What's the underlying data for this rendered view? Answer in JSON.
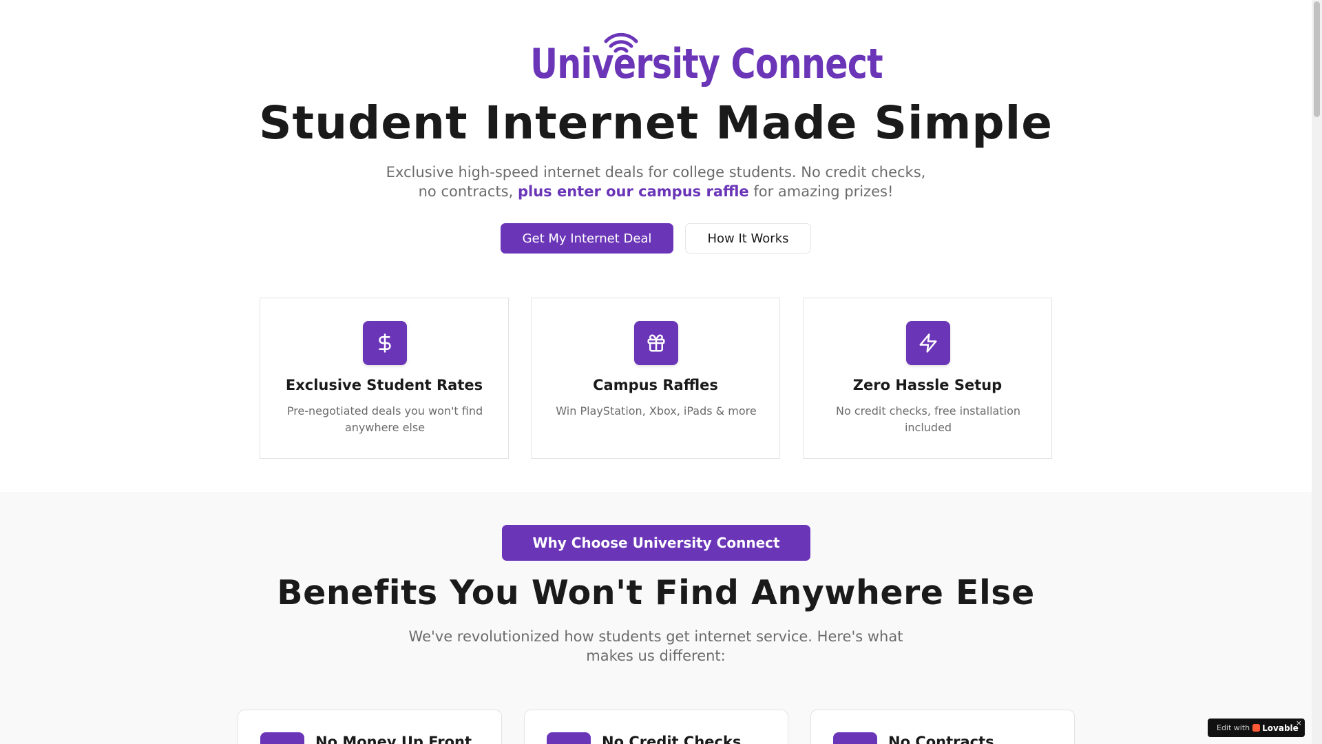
{
  "brand": {
    "logo_text": "University Connect",
    "accent_color": "#6b35b8"
  },
  "hero": {
    "title": "Student Internet Made Simple",
    "subtitle_part1": "Exclusive high-speed internet deals for college students. No credit checks, no contracts, ",
    "subtitle_highlight": "plus enter our campus raffle",
    "subtitle_part2": " for amazing prizes!",
    "primary_button": "Get My Internet Deal",
    "secondary_button": "How It Works"
  },
  "features": [
    {
      "icon": "dollar-icon",
      "title": "Exclusive Student Rates",
      "desc": "Pre-negotiated deals you won't find anywhere else"
    },
    {
      "icon": "gift-icon",
      "title": "Campus Raffles",
      "desc": "Win PlayStation, Xbox, iPads & more"
    },
    {
      "icon": "lightning-icon",
      "title": "Zero Hassle Setup",
      "desc": "No credit checks, free installation included"
    }
  ],
  "benefits": {
    "badge": "Why Choose University Connect",
    "title": "Benefits You Won't Find Anywhere Else",
    "subtitle": "We've revolutionized how students get internet service. Here's what makes us different:",
    "cards": [
      {
        "title": "No Money Up Front"
      },
      {
        "title": "No Credit Checks"
      },
      {
        "title": "No Contracts"
      }
    ]
  },
  "lovable_badge": {
    "edit_label": "Edit with",
    "brand_label": "Lovable",
    "close_label": "×"
  }
}
